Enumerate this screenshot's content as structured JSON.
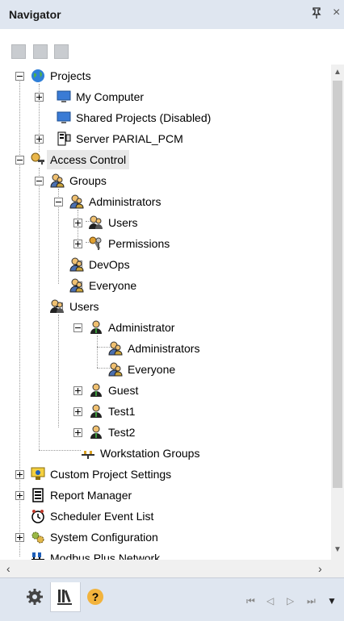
{
  "panel": {
    "title": "Navigator",
    "pin_icon": "pin-icon",
    "close_symbol": "×"
  },
  "toolbar": {
    "icons": [
      "tree-view-icon",
      "expand-icon",
      "collapse-icon"
    ]
  },
  "tree": {
    "projects": "Projects",
    "my_computer": "My Computer",
    "shared_projects": "Shared Projects (Disabled)",
    "server": "Server PARIAL_PCM",
    "access_control": "Access Control",
    "groups": "Groups",
    "administrators_group": "Administrators",
    "admin_users": "Users",
    "admin_permissions": "Permissions",
    "devops": "DevOps",
    "everyone": "Everyone",
    "users": "Users",
    "administrator_user": "Administrator",
    "administrator_member_admins": "Administrators",
    "administrator_member_everyone": "Everyone",
    "guest": "Guest",
    "test1": "Test1",
    "test2": "Test2",
    "workstation_groups": "Workstation Groups",
    "custom_project_settings": "Custom Project Settings",
    "report_manager": "Report Manager",
    "scheduler_event_list": "Scheduler Event List",
    "system_configuration": "System Configuration",
    "modbus_plus_network": "Modbus Plus Network"
  },
  "bottom": {
    "tabs": [
      "settings-gear-icon",
      "library-books-icon",
      "help-icon"
    ],
    "nav": [
      "⏮",
      "◁",
      "▷",
      "⏭",
      "▼"
    ]
  }
}
